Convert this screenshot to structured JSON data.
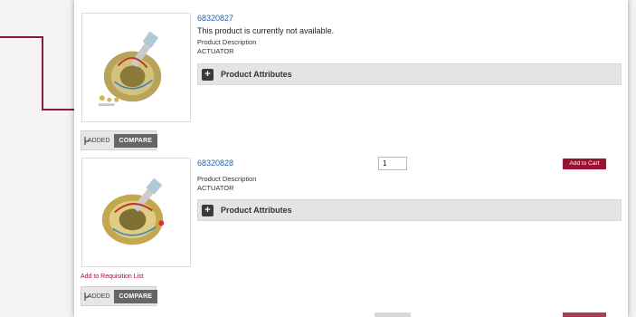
{
  "products": [
    {
      "part_number": "68320827",
      "availability": "This product is currently not available.",
      "description_label": "Product Description",
      "description": "ACTUATOR",
      "attributes_label": "Product Attributes",
      "compare": {
        "added_label": "ADDED",
        "compare_label": "COMPARE",
        "checked": true
      }
    },
    {
      "part_number": "68320828",
      "description_label": "Product Description",
      "description": "ACTUATOR",
      "attributes_label": "Product Attributes",
      "quantity": "1",
      "add_to_cart_label": "Add to Cart",
      "requisition_label": "Add to Requisition List",
      "compare": {
        "added_label": "ADDED",
        "compare_label": "COMPARE",
        "checked": true
      }
    }
  ],
  "colors": {
    "accent": "#9b1132",
    "link": "#1f63a6",
    "callout": "#8a1b35"
  }
}
